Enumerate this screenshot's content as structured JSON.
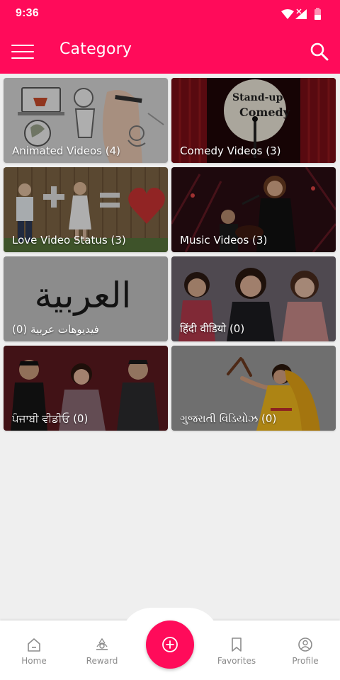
{
  "status_bar": {
    "time": "9:36",
    "icons": [
      "wifi-icon",
      "signal-icon",
      "battery-icon"
    ]
  },
  "toolbar": {
    "title": "Category",
    "menu_icon": "hamburger-menu-icon",
    "search_icon": "search-icon"
  },
  "categories": [
    {
      "label": "Animated Videos (4)"
    },
    {
      "label": "Comedy Videos (3)"
    },
    {
      "label": "Love Video Status (3)"
    },
    {
      "label": "Music Videos (3)"
    },
    {
      "label": "فيديوهات عربية (0)",
      "thumbnail_text": "العربية"
    },
    {
      "label": "हिंदी वीडियो (0)"
    },
    {
      "label": "ਪੰਜਾਬੀ ਵੀਡੀਓ (0)"
    },
    {
      "label": "ગુજરાતી વિડિયોઝ (0)"
    }
  ],
  "bottom_nav": {
    "items": [
      {
        "label": "Home",
        "icon": "home-icon"
      },
      {
        "label": "Reward",
        "icon": "reward-icon"
      },
      {
        "label": "Favorites",
        "icon": "bookmark-icon"
      },
      {
        "label": "Profile",
        "icon": "profile-icon"
      }
    ],
    "fab_icon": "add-circle-icon"
  },
  "colors": {
    "primary": "#ff0b5a",
    "background": "#efefef",
    "nav_text": "#8b8b8b",
    "white": "#ffffff"
  }
}
